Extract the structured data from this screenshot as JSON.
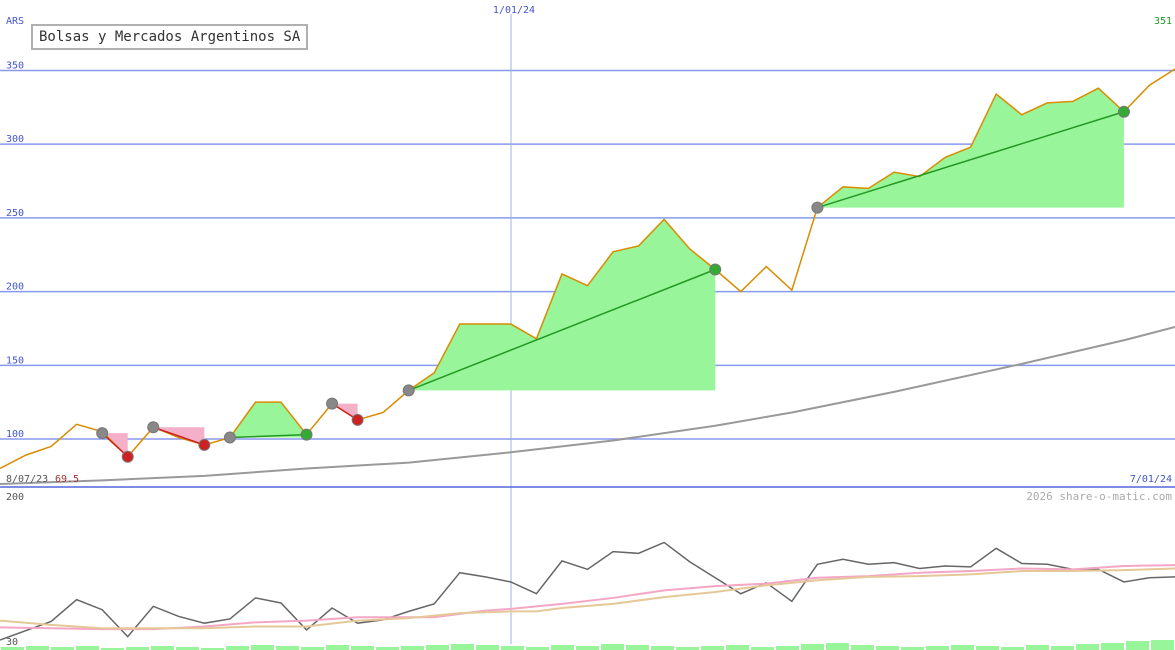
{
  "chart_data": [
    {
      "type": "line",
      "title": "Bolsas y Mercados Argentinos SA",
      "currency_label": "ARS",
      "last_value_label": "351",
      "start_label": "8/07/23",
      "start_value_label": "69.5",
      "mid_date_label": "1/01/24",
      "end_date_label": "7/01/24",
      "y_ticks": [
        "100",
        "150",
        "200",
        "250",
        "300",
        "350"
      ],
      "ylim": [
        69.5,
        351
      ],
      "colors": {
        "price": "#d98c00",
        "moving_average": "#999999",
        "grid": "#8899ee",
        "gain_fill": "#99f599",
        "loss_fill": "#f4b0c8",
        "gain_line": "#229922",
        "loss_line": "#cc2222"
      },
      "price": [
        [
          0,
          80
        ],
        [
          1,
          89
        ],
        [
          2,
          95
        ],
        [
          3,
          110
        ],
        [
          4,
          105
        ],
        [
          5,
          88
        ],
        [
          6,
          108
        ],
        [
          7,
          101
        ],
        [
          8,
          96
        ],
        [
          9,
          101
        ],
        [
          10,
          125
        ],
        [
          11,
          125
        ],
        [
          12,
          103
        ],
        [
          13,
          124
        ],
        [
          14,
          113
        ],
        [
          15,
          118
        ],
        [
          16,
          133
        ],
        [
          17,
          145
        ],
        [
          18,
          178
        ],
        [
          19,
          178
        ],
        [
          20,
          178
        ],
        [
          21,
          168
        ],
        [
          22,
          212
        ],
        [
          23,
          204
        ],
        [
          24,
          227
        ],
        [
          25,
          231
        ],
        [
          26,
          249
        ],
        [
          27,
          229
        ],
        [
          28,
          215
        ],
        [
          29,
          200
        ],
        [
          30,
          217
        ],
        [
          31,
          201
        ],
        [
          32,
          257
        ],
        [
          33,
          271
        ],
        [
          34,
          270
        ],
        [
          35,
          281
        ],
        [
          36,
          278
        ],
        [
          37,
          291
        ],
        [
          38,
          298
        ],
        [
          39,
          334
        ],
        [
          40,
          320
        ],
        [
          41,
          328
        ],
        [
          42,
          329
        ],
        [
          43,
          338
        ],
        [
          44,
          322
        ],
        [
          45,
          340
        ],
        [
          46,
          351
        ]
      ],
      "moving_average": [
        [
          0,
          69.5
        ],
        [
          4,
          72
        ],
        [
          8,
          75
        ],
        [
          12,
          80
        ],
        [
          16,
          84
        ],
        [
          20,
          91
        ],
        [
          24,
          99
        ],
        [
          26,
          104
        ],
        [
          28,
          109
        ],
        [
          31,
          118
        ],
        [
          35,
          132
        ],
        [
          40,
          151
        ],
        [
          44,
          167
        ],
        [
          46,
          176
        ]
      ],
      "trades": [
        {
          "x0": 4,
          "y0": 104,
          "x1": 5,
          "y1": 88,
          "result": "loss"
        },
        {
          "x0": 6,
          "y0": 108,
          "x1": 8,
          "y1": 96,
          "result": "loss"
        },
        {
          "x0": 9,
          "y0": 101,
          "x1": 12,
          "y1": 103,
          "result": "gain"
        },
        {
          "x0": 13,
          "y0": 124,
          "x1": 14,
          "y1": 113,
          "result": "loss"
        },
        {
          "x0": 16,
          "y0": 133,
          "x1": 28,
          "y1": 215,
          "result": "gain"
        },
        {
          "x0": 32,
          "y0": 257,
          "x1": 44,
          "y1": 322,
          "result": "gain"
        }
      ]
    },
    {
      "type": "line",
      "watermark": "2026 share-o-matic.com",
      "y_ticks": [
        "200",
        "30"
      ],
      "ylim": [
        30,
        200
      ],
      "colors": {
        "line1": "#666666",
        "line2": "#f4a6c6",
        "line3": "#e6c898",
        "volume": "#99f599"
      },
      "series": [
        {
          "values": [
            [
              0,
              30
            ],
            [
              2,
              52
            ],
            [
              3,
              78
            ],
            [
              4,
              66
            ],
            [
              5,
              34
            ],
            [
              6,
              70
            ],
            [
              7,
              58
            ],
            [
              8,
              50
            ],
            [
              9,
              55
            ],
            [
              10,
              80
            ],
            [
              11,
              74
            ],
            [
              12,
              42
            ],
            [
              13,
              68
            ],
            [
              14,
              50
            ],
            [
              15,
              54
            ],
            [
              16,
              64
            ],
            [
              17,
              73
            ],
            [
              18,
              110
            ],
            [
              19,
              105
            ],
            [
              20,
              99
            ],
            [
              21,
              85
            ],
            [
              22,
              124
            ],
            [
              23,
              114
            ],
            [
              24,
              135
            ],
            [
              25,
              133
            ],
            [
              26,
              146
            ],
            [
              27,
              123
            ],
            [
              28,
              104
            ],
            [
              29,
              85
            ],
            [
              30,
              98
            ],
            [
              31,
              76
            ],
            [
              32,
              120
            ],
            [
              33,
              126
            ],
            [
              34,
              120
            ],
            [
              35,
              122
            ],
            [
              36,
              115
            ],
            [
              37,
              118
            ],
            [
              38,
              117
            ],
            [
              39,
              139
            ],
            [
              40,
              121
            ],
            [
              41,
              120
            ],
            [
              42,
              114
            ],
            [
              43,
              114
            ],
            [
              44,
              99
            ],
            [
              45,
              104
            ],
            [
              46,
              105
            ]
          ]
        },
        {
          "values": [
            [
              0,
              45
            ],
            [
              2,
              44
            ],
            [
              4,
              43
            ],
            [
              6,
              43
            ],
            [
              8,
              46
            ],
            [
              10,
              51
            ],
            [
              12,
              53
            ],
            [
              14,
              57
            ],
            [
              16,
              57
            ],
            [
              17,
              57
            ],
            [
              18,
              61
            ],
            [
              19,
              65
            ],
            [
              20,
              67
            ],
            [
              22,
              73
            ],
            [
              24,
              80
            ],
            [
              26,
              89
            ],
            [
              28,
              94
            ],
            [
              30,
              97
            ],
            [
              32,
              104
            ],
            [
              34,
              106
            ],
            [
              36,
              110
            ],
            [
              38,
              112
            ],
            [
              40,
              115
            ],
            [
              42,
              114
            ],
            [
              44,
              118
            ],
            [
              46,
              119
            ]
          ]
        },
        {
          "values": [
            [
              0,
              53
            ],
            [
              2,
              48
            ],
            [
              4,
              44
            ],
            [
              6,
              44
            ],
            [
              8,
              44
            ],
            [
              10,
              46
            ],
            [
              12,
              46
            ],
            [
              14,
              53
            ],
            [
              16,
              56
            ],
            [
              18,
              62
            ],
            [
              20,
              64
            ],
            [
              21,
              64
            ],
            [
              22,
              68
            ],
            [
              24,
              73
            ],
            [
              26,
              81
            ],
            [
              28,
              87
            ],
            [
              30,
              95
            ],
            [
              32,
              101
            ],
            [
              34,
              105
            ],
            [
              36,
              106
            ],
            [
              38,
              108
            ],
            [
              40,
              112
            ],
            [
              42,
              112
            ],
            [
              44,
              113
            ],
            [
              46,
              115
            ]
          ]
        }
      ],
      "volume": [
        3,
        4,
        3,
        4,
        2,
        3,
        4,
        3,
        2,
        4,
        5,
        4,
        3,
        5,
        4,
        3,
        4,
        5,
        6,
        5,
        4,
        3,
        5,
        4,
        6,
        5,
        4,
        3,
        4,
        5,
        3,
        4,
        6,
        7,
        5,
        4,
        3,
        4,
        5,
        4,
        3,
        5,
        4,
        6,
        7,
        9,
        10
      ]
    }
  ]
}
